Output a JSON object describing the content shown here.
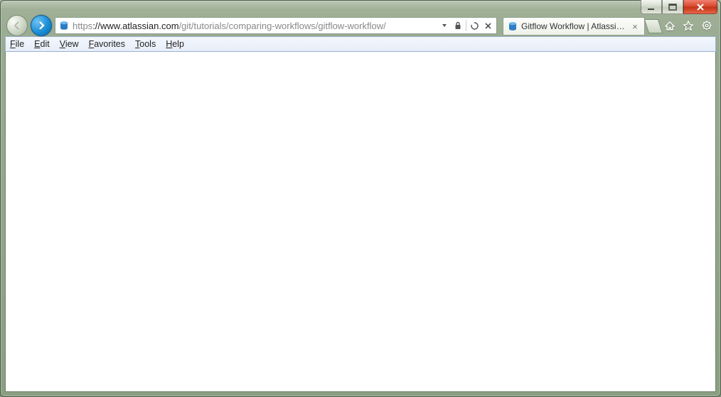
{
  "window": {
    "caption": {
      "minimize": "",
      "maximize": "",
      "close": ""
    }
  },
  "nav": {
    "url_proto": "https",
    "url_host": "://www.atlassian.com",
    "url_path": "/git/tutorials/comparing-workflows/gitflow-workflow/"
  },
  "tab": {
    "title": "Gitflow Workflow | Atlassia..."
  },
  "menu": {
    "file": "File",
    "edit": "Edit",
    "view": "View",
    "favorites": "Favorites",
    "tools": "Tools",
    "help": "Help"
  }
}
